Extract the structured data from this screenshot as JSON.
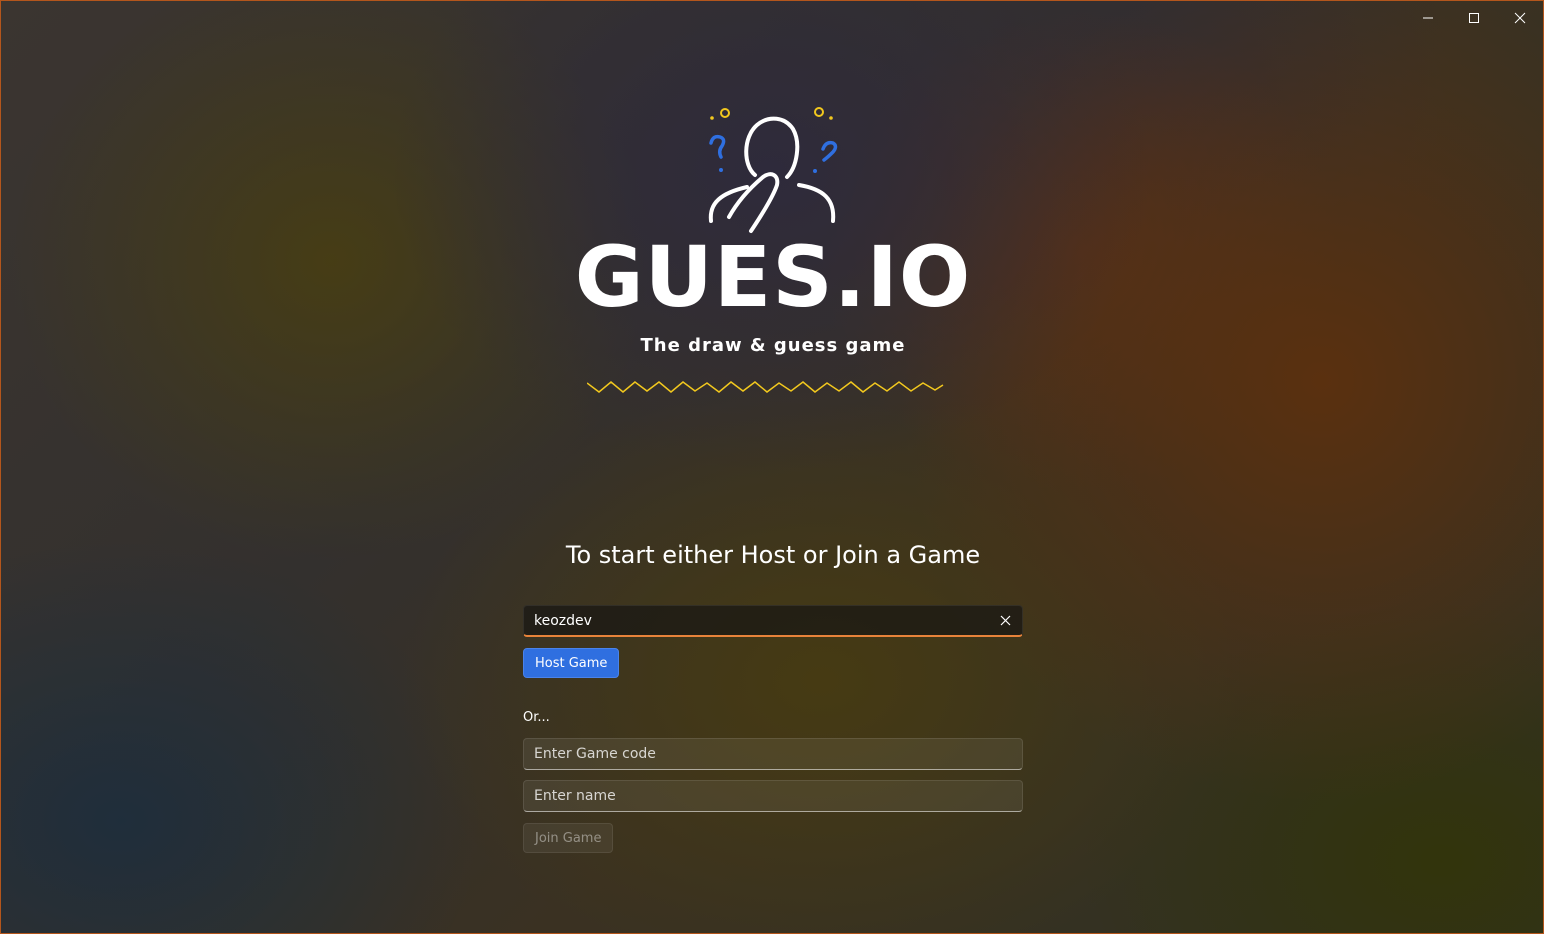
{
  "window": {
    "controls": {
      "minimize_icon": "minimize-icon",
      "maximize_icon": "maximize-icon",
      "close_icon": "close-icon"
    }
  },
  "brand": {
    "title": "GUES.IO",
    "tagline": "The draw & guess game",
    "colors": {
      "accent_yellow": "#f2c81e",
      "accent_blue": "#2f6fe0",
      "focus_orange": "#e8833a"
    }
  },
  "main": {
    "heading": "To start either Host or Join a Game",
    "host": {
      "name_value": "keozdev",
      "clear_icon": "close-icon",
      "host_button_label": "Host Game"
    },
    "or_label": "Or...",
    "join": {
      "game_code_placeholder": "Enter Game code",
      "game_code_value": "",
      "name_placeholder": "Enter name",
      "name_value": "",
      "join_button_label": "Join Game"
    }
  }
}
